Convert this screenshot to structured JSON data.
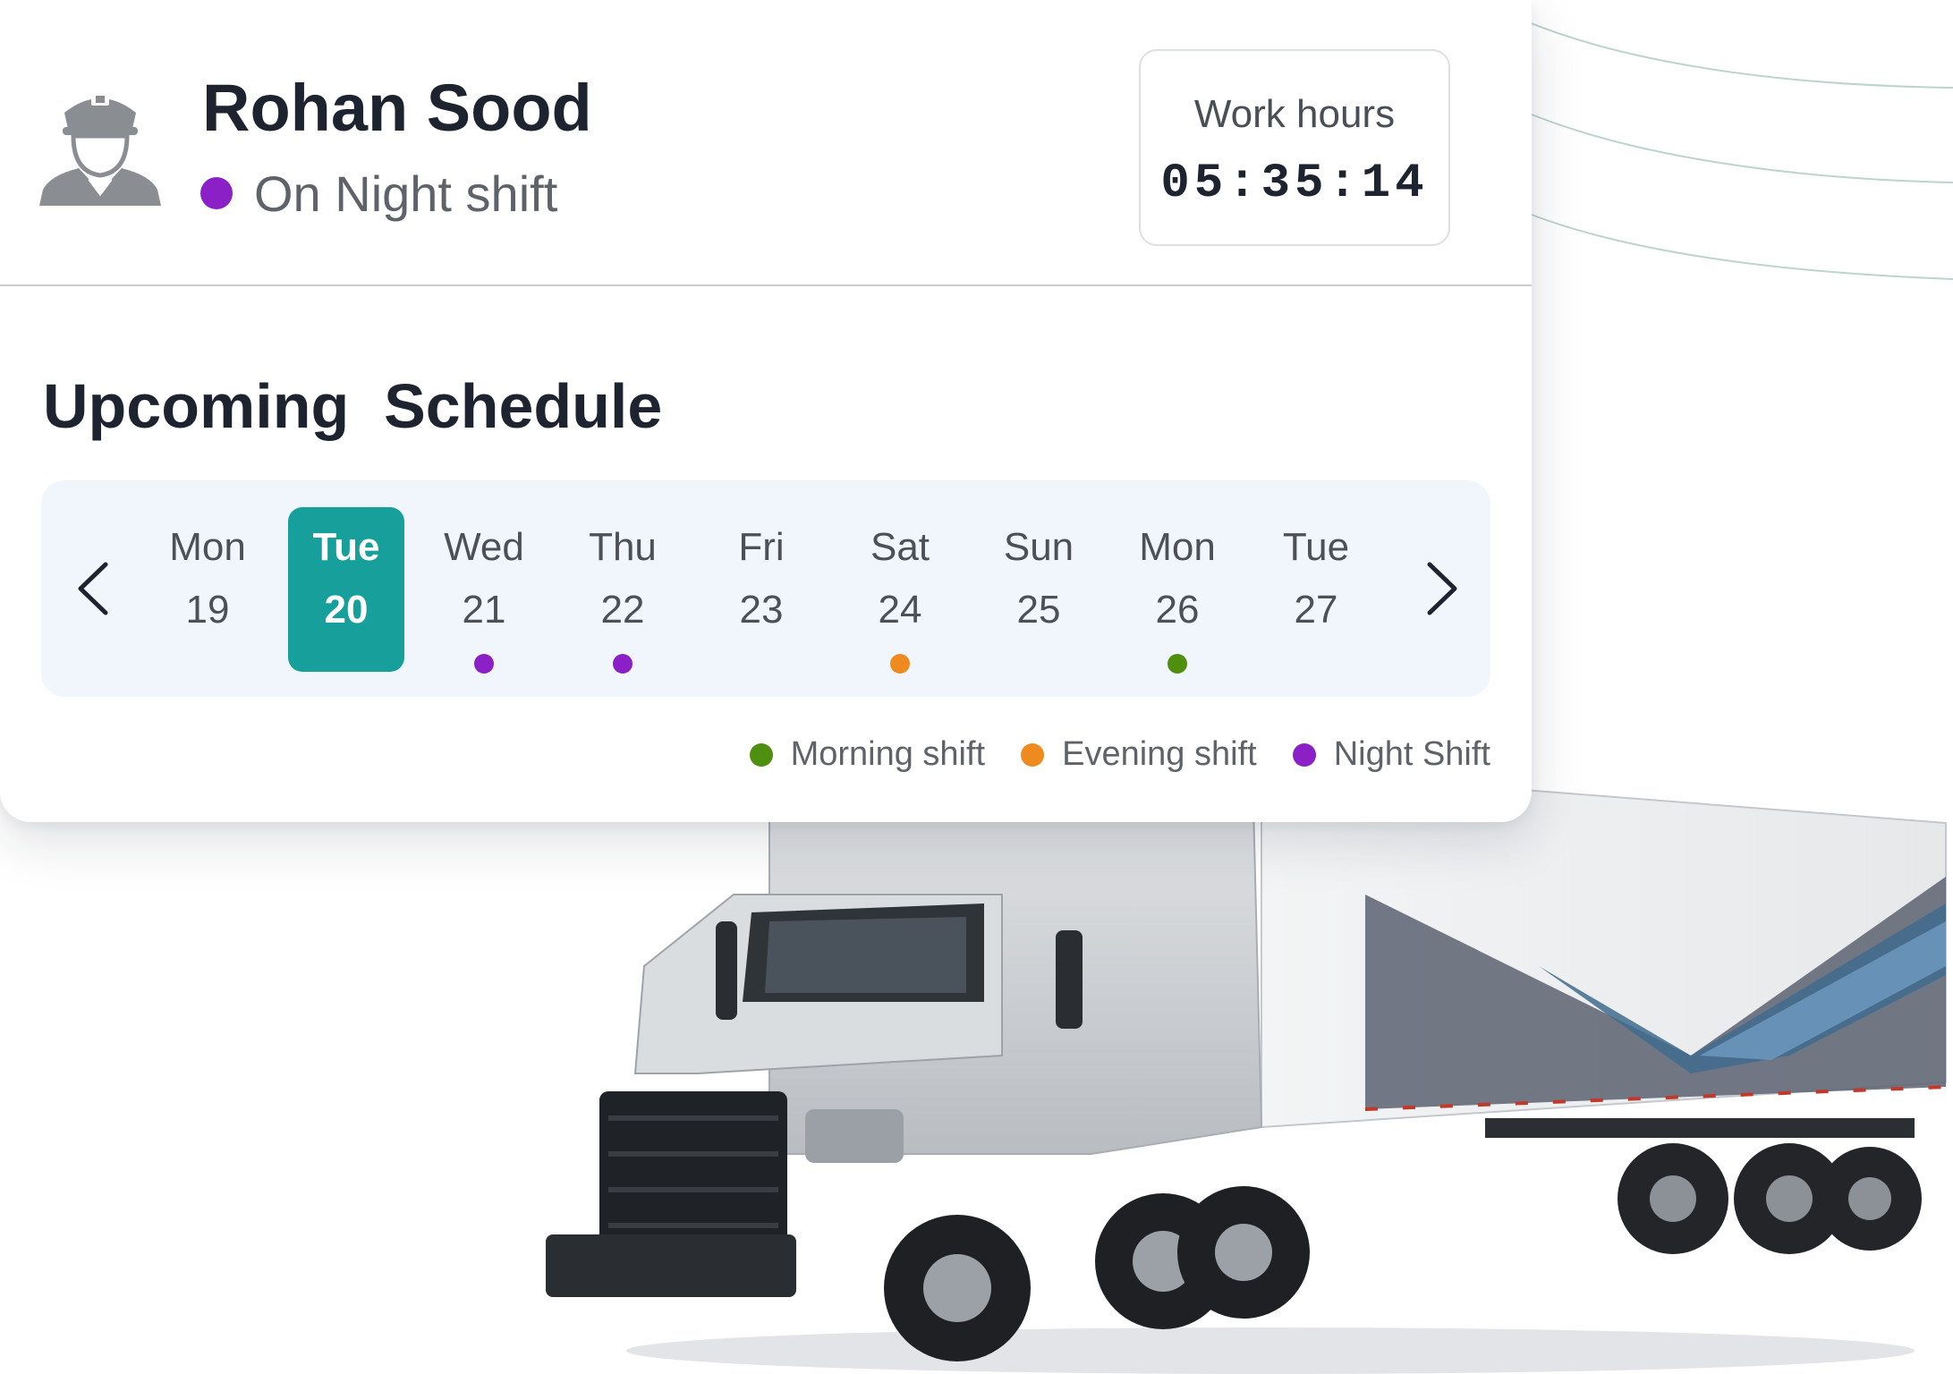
{
  "driver": {
    "name": "Rohan Sood",
    "status": "On Night shift",
    "status_color": "#8b20c7"
  },
  "work_hours": {
    "label": "Work hours",
    "value": "05:35:14"
  },
  "schedule": {
    "title": "Upcoming  Schedule",
    "days": [
      {
        "name": "Mon",
        "num": "19",
        "shift": null
      },
      {
        "name": "Tue",
        "num": "20",
        "shift": null,
        "selected": true
      },
      {
        "name": "Wed",
        "num": "21",
        "shift": "night"
      },
      {
        "name": "Thu",
        "num": "22",
        "shift": "night"
      },
      {
        "name": "Fri",
        "num": "23",
        "shift": null
      },
      {
        "name": "Sat",
        "num": "24",
        "shift": "evening"
      },
      {
        "name": "Sun",
        "num": "25",
        "shift": null
      },
      {
        "name": "Mon",
        "num": "26",
        "shift": "morning"
      },
      {
        "name": "Tue",
        "num": "27",
        "shift": null
      }
    ]
  },
  "legend": {
    "morning": {
      "label": "Morning shift",
      "color": "#4e8f0f"
    },
    "evening": {
      "label": "Evening shift",
      "color": "#ef8b1e"
    },
    "night": {
      "label": "Night Shift",
      "color": "#8b20c7"
    }
  },
  "colors": {
    "accent": "#17a09b",
    "text_dark": "#1e2330"
  },
  "icons": {
    "driver": "driver-avatar-icon",
    "prev": "chevron-left-icon",
    "next": "chevron-right-icon"
  }
}
